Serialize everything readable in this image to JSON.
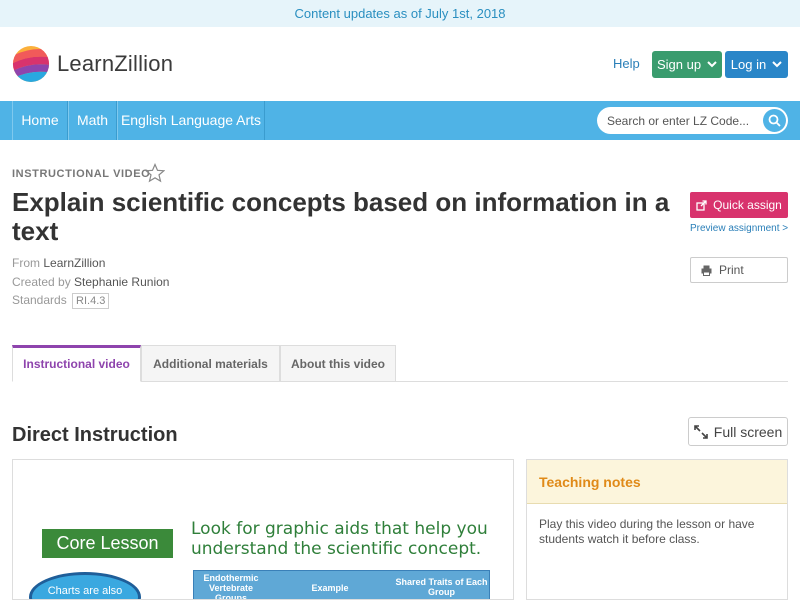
{
  "banner": {
    "text": "Content updates as of July 1st, 2018"
  },
  "header": {
    "logo_text": "LearnZillion",
    "help_label": "Help",
    "signup_label": "Sign up",
    "login_label": "Log in"
  },
  "nav": {
    "items": [
      {
        "label": "Home"
      },
      {
        "label": "Math"
      },
      {
        "label": "English Language Arts"
      }
    ],
    "search_placeholder": "Search or enter LZ Code..."
  },
  "lesson": {
    "kicker": "INSTRUCTIONAL VIDEO",
    "title": "Explain scientific concepts based on information in a text",
    "from_label": "From",
    "from_value": "LearnZillion",
    "created_label": "Created by",
    "created_value": "Stephanie Runion",
    "standards_label": "Standards",
    "standards_value": "RI.4.3"
  },
  "actions": {
    "quick_assign": "Quick assign",
    "preview_assignment": "Preview assignment >",
    "print": "Print"
  },
  "tabs": [
    {
      "label": "Instructional video",
      "active": true
    },
    {
      "label": "Additional materials",
      "active": false
    },
    {
      "label": "About this video",
      "active": false
    }
  ],
  "section": {
    "title": "Direct Instruction",
    "fullscreen_label": "Full screen"
  },
  "video": {
    "core_lesson": "Core Lesson",
    "headline": "Look for graphic aids that help you understand the scientific concept.",
    "bubble_text": "Charts are also",
    "table_headers": [
      "Endothermic Vertebrate Groups",
      "Example",
      "Shared Traits of Each Group"
    ]
  },
  "teaching_notes": {
    "title": "Teaching notes",
    "body": "Play this video during the lesson or have students watch it before class."
  },
  "colors": {
    "nav": "#4fb3e6",
    "signup": "#3a9c6e",
    "login": "#2a86c8",
    "quick_assign": "#d8336d",
    "active_tab": "#8e44ad",
    "notes_title": "#e08a18"
  }
}
